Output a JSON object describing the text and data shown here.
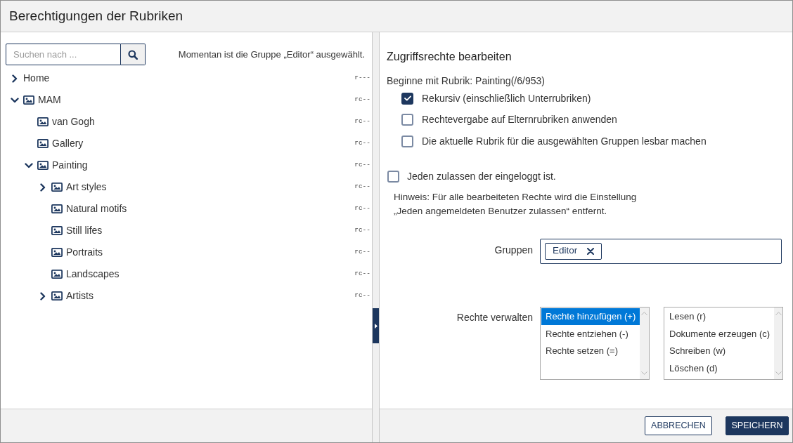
{
  "window": {
    "title": "Berechtigungen der Rubriken"
  },
  "search": {
    "placeholder": "Suchen nach ..."
  },
  "selection_info": "Momentan ist die Gruppe „Editor“ ausgewählt.",
  "tree": [
    {
      "kind": "plain",
      "label": "Home",
      "rights": "r---",
      "expanded": false
    },
    {
      "kind": "image",
      "label": "MAM",
      "rights": "rc--",
      "expanded": true,
      "children": [
        {
          "kind": "image",
          "label": "van Gogh",
          "rights": "rc--"
        },
        {
          "kind": "image",
          "label": "Gallery",
          "rights": "rc--"
        },
        {
          "kind": "image",
          "label": "Painting",
          "rights": "rc--",
          "expanded": true,
          "children": [
            {
              "kind": "image",
              "label": "Art styles",
              "rights": "rc--",
              "expanded": false
            },
            {
              "kind": "image",
              "label": "Natural motifs",
              "rights": "rc--"
            },
            {
              "kind": "image",
              "label": "Still lifes",
              "rights": "rc--"
            },
            {
              "kind": "image",
              "label": "Portraits",
              "rights": "rc--"
            },
            {
              "kind": "image",
              "label": "Landscapes",
              "rights": "rc--"
            },
            {
              "kind": "image",
              "label": "Artists",
              "rights": "rc--",
              "expanded": false
            }
          ]
        }
      ]
    }
  ],
  "editor": {
    "title": "Zugriffsrechte bearbeiten",
    "start": "Beginne mit Rubrik: Painting(/6/953)",
    "options": [
      {
        "label": "Rekursiv (einschließlich Unterrubriken)",
        "checked": true
      },
      {
        "label": "Rechtevergabe auf Elternrubriken anwenden",
        "checked": false
      },
      {
        "label": "Die aktuelle Rubrik für die ausgewählten Gruppen lesbar machen",
        "checked": false
      }
    ],
    "login_option": {
      "label": "Jeden zulassen der eingeloggt ist.",
      "checked": false
    },
    "note": [
      "Hinweis: Für alle bearbeiteten Rechte wird die Einstellung",
      "„Jeden angemeldeten Benutzer zulassen“ entfernt."
    ],
    "groups": {
      "label": "Gruppen",
      "tags": [
        {
          "label": "Editor"
        }
      ]
    },
    "rights": {
      "label": "Rechte verwalten",
      "modes": [
        {
          "label": "Rechte hinzufügen (+)",
          "selected": true
        },
        {
          "label": "Rechte entziehen (-)",
          "selected": false
        },
        {
          "label": "Rechte setzen (=)",
          "selected": false
        }
      ],
      "permissions": [
        {
          "label": "Lesen (r)",
          "selected": false
        },
        {
          "label": "Dokumente erzeugen (c)",
          "selected": false
        },
        {
          "label": "Schreiben (w)",
          "selected": false
        },
        {
          "label": "Löschen (d)",
          "selected": false
        }
      ]
    }
  },
  "footer": {
    "buttons": [
      {
        "label": "ABBRECHEN",
        "kind": "secondary"
      },
      {
        "label": "SPEICHERN",
        "kind": "primary"
      }
    ]
  }
}
